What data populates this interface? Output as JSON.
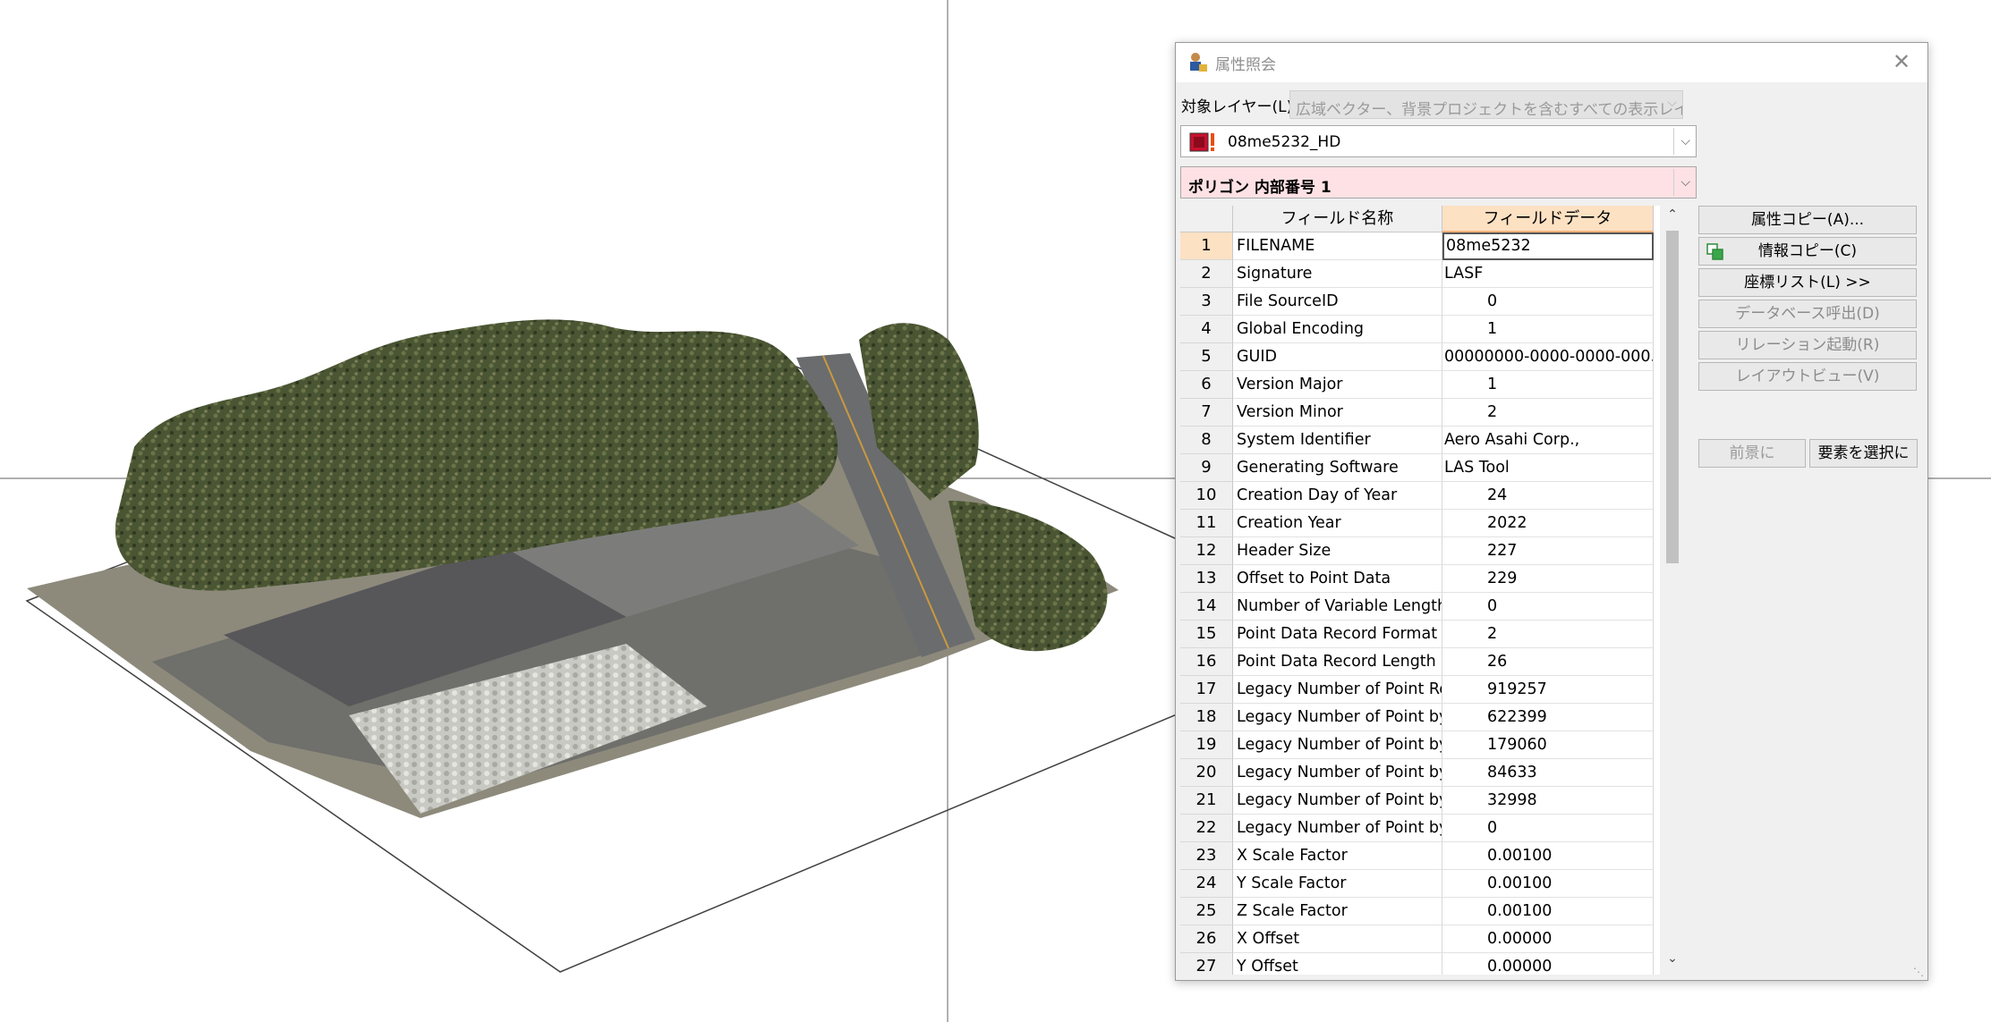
{
  "dialog": {
    "title": "属性照会",
    "close": "✕",
    "layer_label": "対象レイヤー(L)",
    "layer_scope": "広域ベクター、背景プロジェクトを含むすべての表示レイ",
    "layer_name": "08me5232_HD",
    "feature": "ポリゴン 内部番号 1"
  },
  "grid": {
    "header_name": "フィールド名称",
    "header_data": "フィールドデータ",
    "rows": [
      {
        "num": "1",
        "name": "FILENAME",
        "value": "08me5232"
      },
      {
        "num": "2",
        "name": "Signature",
        "value": "LASF"
      },
      {
        "num": "3",
        "name": "File SourceID",
        "value": "0"
      },
      {
        "num": "4",
        "name": "Global Encoding",
        "value": "1"
      },
      {
        "num": "5",
        "name": "GUID",
        "value": "00000000-0000-0000-000..."
      },
      {
        "num": "6",
        "name": "Version Major",
        "value": "1"
      },
      {
        "num": "7",
        "name": "Version Minor",
        "value": "2"
      },
      {
        "num": "8",
        "name": "System Identifier",
        "value": "Aero Asahi Corp.,"
      },
      {
        "num": "9",
        "name": "Generating Software",
        "value": "LAS Tool"
      },
      {
        "num": "10",
        "name": "Creation Day of Year",
        "value": "24"
      },
      {
        "num": "11",
        "name": "Creation Year",
        "value": "2022"
      },
      {
        "num": "12",
        "name": "Header Size",
        "value": "227"
      },
      {
        "num": "13",
        "name": "Offset to Point Data",
        "value": "229"
      },
      {
        "num": "14",
        "name": "Number of Variable Length",
        "value": "0"
      },
      {
        "num": "15",
        "name": "Point Data Record Format",
        "value": "2"
      },
      {
        "num": "16",
        "name": "Point Data Record Length",
        "value": "26"
      },
      {
        "num": "17",
        "name": "Legacy Number of Point Rec",
        "value": "919257"
      },
      {
        "num": "18",
        "name": "Legacy Number of Point by",
        "value": "622399"
      },
      {
        "num": "19",
        "name": "Legacy Number of Point by",
        "value": "179060"
      },
      {
        "num": "20",
        "name": "Legacy Number of Point by",
        "value": "84633"
      },
      {
        "num": "21",
        "name": "Legacy Number of Point by",
        "value": "32998"
      },
      {
        "num": "22",
        "name": "Legacy Number of Point by",
        "value": "0"
      },
      {
        "num": "23",
        "name": "X Scale Factor",
        "value": "0.00100"
      },
      {
        "num": "24",
        "name": "Y Scale Factor",
        "value": "0.00100"
      },
      {
        "num": "25",
        "name": "Z Scale Factor",
        "value": "0.00100"
      },
      {
        "num": "26",
        "name": "X Offset",
        "value": "0.00000"
      },
      {
        "num": "27",
        "name": "Y Offset",
        "value": "0.00000"
      }
    ]
  },
  "buttons": {
    "copy_attr": "属性コピー(A)...",
    "copy_info": "情報コピー(C)",
    "coord_list": "座標リスト(L) >>",
    "db_call": "データベース呼出(D)",
    "relation": "リレーション起動(R)",
    "layout_view": "レイアウトビュー(V)",
    "foreground": "前景に",
    "select_elem": "要素を選択に"
  },
  "icons": {
    "title": "attribute-query-icon",
    "layer": "pointcloud-layer-icon",
    "copy_info": "copy-info-icon"
  }
}
